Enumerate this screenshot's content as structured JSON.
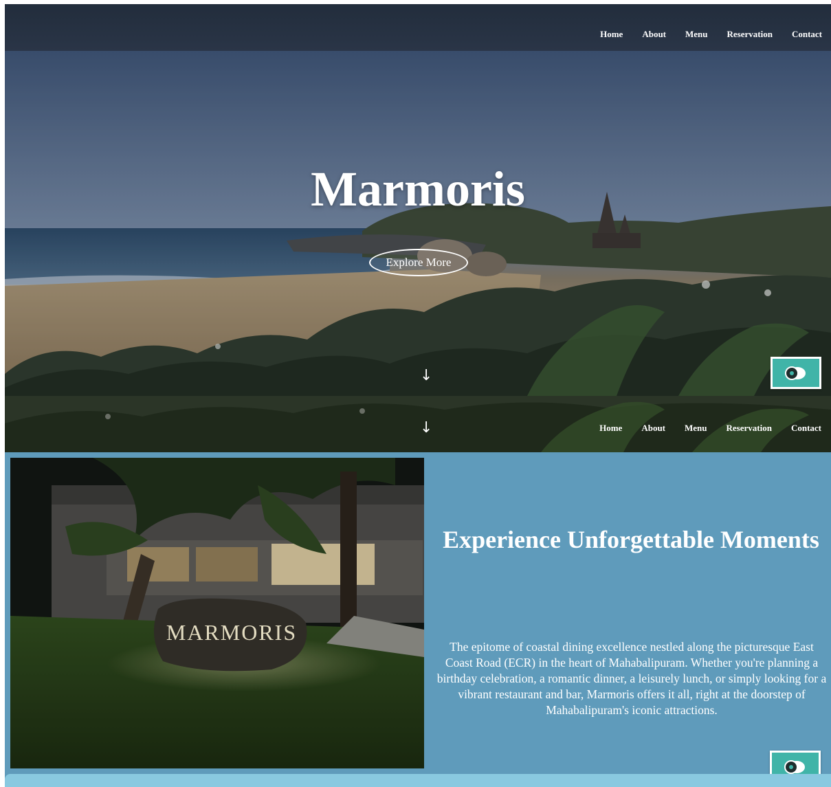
{
  "nav": {
    "items": [
      {
        "label": "Home"
      },
      {
        "label": "About"
      },
      {
        "label": "Menu"
      },
      {
        "label": "Reservation"
      },
      {
        "label": "Contact"
      }
    ]
  },
  "hero": {
    "title": "Marmoris",
    "cta_label": "Explore More",
    "scroll_icon": "↓"
  },
  "chat_widget": {
    "icon": "chat-bubble-icon",
    "color": "#40b4a8"
  },
  "about": {
    "sign_text": "MARMORIS",
    "title": "Experience Unforgettable Moments",
    "body": "The epitome of coastal dining excellence nestled along the picturesque East Coast Road (ECR) in the heart of Mahabalipuram. Whether you're planning a birthday celebration, a romantic dinner, a leisurely lunch, or simply looking for a vibrant restaurant and bar, Marmoris offers it all, right at the doorstep of Mahabalipuram's iconic attractions."
  },
  "colors": {
    "nav_bg": "#232e3d",
    "about_bg": "#5f9bbb",
    "bottom_band": "#89c9e0",
    "chat_accent": "#40b4a8"
  }
}
